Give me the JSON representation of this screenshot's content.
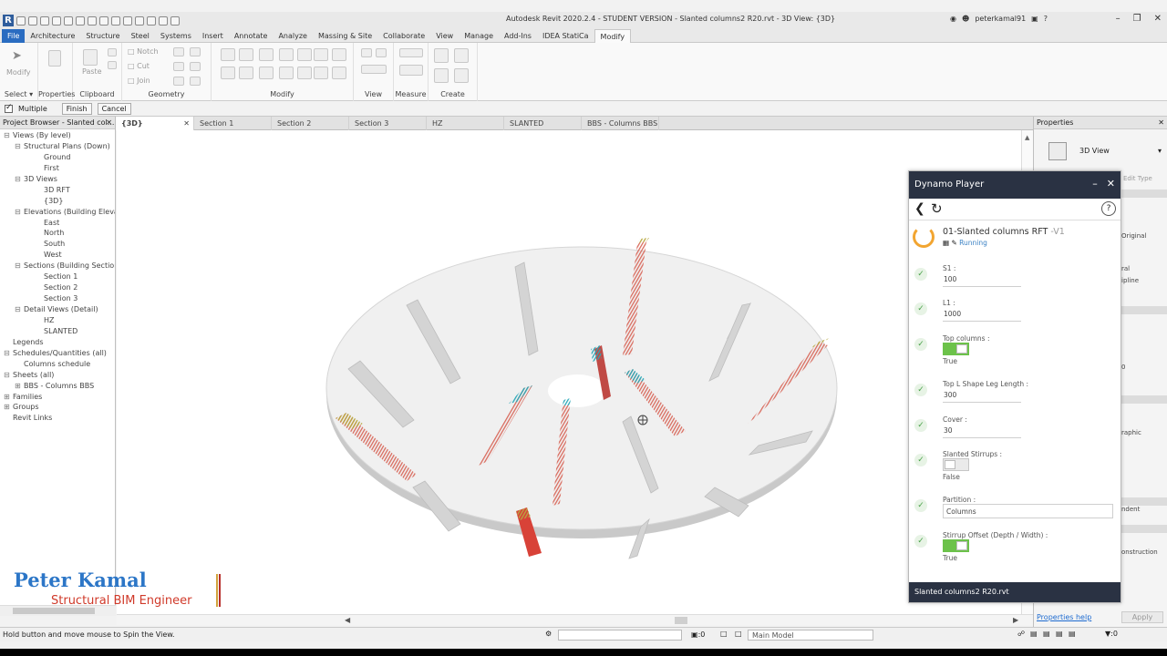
{
  "window": {
    "title": "Autodesk Revit 2020.2.4 - STUDENT VERSION - Slanted columns2 R20.rvt - 3D View: {3D}",
    "user": "peterkamal91"
  },
  "ribbon_tabs": [
    "File",
    "Architecture",
    "Structure",
    "Steel",
    "Systems",
    "Insert",
    "Annotate",
    "Analyze",
    "Massing & Site",
    "Collaborate",
    "View",
    "Manage",
    "Add-Ins",
    "IDEA StatiCa",
    "Modify"
  ],
  "ribbon": {
    "modify_tool": "Modify",
    "paste": "Paste",
    "notch": "Notch",
    "cut": "Cut",
    "join": "Join",
    "panels": {
      "select": "Select",
      "properties": "Properties",
      "clipboard": "Clipboard",
      "geometry": "Geometry",
      "modify": "Modify",
      "view": "View",
      "measure": "Measure",
      "create": "Create"
    }
  },
  "options_bar": {
    "multiple": "Multiple",
    "finish": "Finish",
    "cancel": "Cancel"
  },
  "project_browser": {
    "title": "Project Browser - Slanted col...",
    "items": [
      {
        "label": "Views (By level)",
        "indent": 0,
        "toggle": "⊟"
      },
      {
        "label": "Structural Plans (Down)",
        "indent": 1,
        "toggle": "⊟"
      },
      {
        "label": "Ground",
        "indent": 2,
        "toggle": ""
      },
      {
        "label": "First",
        "indent": 2,
        "toggle": ""
      },
      {
        "label": "3D Views",
        "indent": 1,
        "toggle": "⊟"
      },
      {
        "label": "3D RFT",
        "indent": 2,
        "toggle": ""
      },
      {
        "label": "{3D}",
        "indent": 2,
        "toggle": ""
      },
      {
        "label": "Elevations (Building Elevati",
        "indent": 1,
        "toggle": "⊟"
      },
      {
        "label": "East",
        "indent": 2,
        "toggle": ""
      },
      {
        "label": "North",
        "indent": 2,
        "toggle": ""
      },
      {
        "label": "South",
        "indent": 2,
        "toggle": ""
      },
      {
        "label": "West",
        "indent": 2,
        "toggle": ""
      },
      {
        "label": "Sections (Building Section",
        "indent": 1,
        "toggle": "⊟"
      },
      {
        "label": "Section 1",
        "indent": 2,
        "toggle": ""
      },
      {
        "label": "Section 2",
        "indent": 2,
        "toggle": ""
      },
      {
        "label": "Section 3",
        "indent": 2,
        "toggle": ""
      },
      {
        "label": "Detail Views (Detail)",
        "indent": 1,
        "toggle": "⊟"
      },
      {
        "label": "HZ",
        "indent": 2,
        "toggle": ""
      },
      {
        "label": "SLANTED",
        "indent": 2,
        "toggle": ""
      },
      {
        "label": "Legends",
        "indent": 0,
        "toggle": ""
      },
      {
        "label": "Schedules/Quantities (all)",
        "indent": 0,
        "toggle": "⊟"
      },
      {
        "label": "Columns schedule",
        "indent": 1,
        "toggle": ""
      },
      {
        "label": "Sheets (all)",
        "indent": 0,
        "toggle": "⊟"
      },
      {
        "label": "BBS - Columns BBS",
        "indent": 1,
        "toggle": "⊞"
      },
      {
        "label": "Families",
        "indent": 0,
        "toggle": "⊞"
      },
      {
        "label": "Groups",
        "indent": 0,
        "toggle": "⊞"
      },
      {
        "label": "Revit Links",
        "indent": 0,
        "toggle": ""
      }
    ]
  },
  "view_tabs": [
    "{3D}",
    "Section 1",
    "Section 2",
    "Section 3",
    "HZ",
    "SLANTED",
    "BBS - Columns BBS"
  ],
  "properties": {
    "title": "Properties",
    "type": "3D View",
    "edit_type": "Edit Type",
    "fragments": [
      "Original",
      "ral",
      "ipline",
      "0",
      "raphic",
      "ndent",
      "onstruction"
    ],
    "help": "Properties help",
    "apply": "Apply"
  },
  "dynamo": {
    "title": "Dynamo Player",
    "script": "01-Slanted columns RFT",
    "version": "-V1",
    "status": "Running",
    "params": [
      {
        "label": "S1 :",
        "kind": "text",
        "value": "100"
      },
      {
        "label": "L1 :",
        "kind": "text",
        "value": "1000"
      },
      {
        "label": "Top columns :",
        "kind": "bool",
        "value": "True",
        "on": true
      },
      {
        "label": "Top L Shape Leg Length :",
        "kind": "text",
        "value": "300"
      },
      {
        "label": "Cover :",
        "kind": "text",
        "value": "30"
      },
      {
        "label": "Slanted Stirrups :",
        "kind": "bool",
        "value": "False",
        "on": false
      },
      {
        "label": "Partition :",
        "kind": "wide",
        "value": "Columns"
      },
      {
        "label": "Stirrup Offset (Depth / Width) :",
        "kind": "bool",
        "value": "True",
        "on": true
      }
    ],
    "footer": "Slanted columns2 R20.rvt"
  },
  "status_bar": {
    "text": "Hold button and move mouse to Spin the View.",
    "zero": ":0",
    "model": "Main Model",
    "filter": ":0"
  },
  "watermark": {
    "name": "Peter Kamal",
    "role": "Structural  BIM Engineer"
  },
  "colors": {
    "file_tab": "#2a6cc1",
    "dynamo_header": "#2a3243",
    "toggle_on": "#6cc24a",
    "watermark_blue": "#2c76c7",
    "watermark_red": "#d03a2a"
  }
}
